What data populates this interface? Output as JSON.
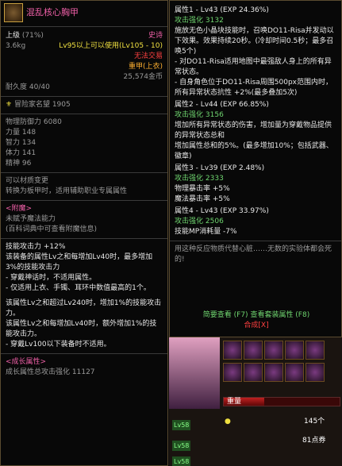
{
  "item": {
    "name": "混乱核心胸甲",
    "grade": "上级",
    "grade_pct": "(71%)",
    "rarity": "史诗",
    "weight": "3.6kg",
    "level_req": "Lv95以上可以使用(Lv105 - 10)",
    "trade": "无法交易",
    "type": "重甲(上衣)",
    "price": "25,574金币",
    "durability": "耐久度 40/40",
    "fame": "冒险家名望 1905",
    "stats": [
      {
        "label": "物理防御力",
        "value": "6080"
      },
      {
        "label": "力量",
        "value": "148"
      },
      {
        "label": "智力",
        "value": "134"
      },
      {
        "label": "体力",
        "value": "141"
      },
      {
        "label": "精神",
        "value": "96"
      }
    ],
    "material_change": "可以材质变更",
    "material_desc": "转换为板甲时，适用辅助职业专属属性",
    "enchant_header": "<附魔>",
    "enchant_none": "未赋予魔法能力",
    "enchant_hint": "(百科词典中可查看附魔信息)",
    "skill_atk": "技能攻击力 +12%",
    "desc1": [
      "该装备的属性Lv之和每增加Lv40时，最多增加3%的技能攻击力",
      "- 穿戴神话时，不适用属性。",
      "- 仅适用上衣、手镯、耳环中数值最高的1个。"
    ],
    "desc2": [
      "该属性Lv之和超过Lv240时，增加1%的技能攻击力。",
      "该属性Lv之和每增加Lv40时，额外增加1%的技能攻击力。",
      "- 穿戴Lv100以下装备时不适用。"
    ],
    "growth_header": "<成长属性>",
    "growth_total": "成长属性总攻击强化",
    "growth_value": "11127"
  },
  "attrs": [
    {
      "title": "属性1 - Lv43 (EXP 24.36%)",
      "atk_label": "攻击强化",
      "atk": "3132",
      "lines": [
        "施放无色小晶块技能时，召唤DO11-Risa并发动以下效果。效果持续20秒。(冷却时间0.5秒；最多召唤5个)",
        "- 对DO11-Risa适用地图中最强敌人身上的所有异常状态。",
        "- 自身角色位于DO11-Risa周围500px范围内时，所有异常状态抗性 +2%(最多叠加5次)"
      ]
    },
    {
      "title": "属性2 - Lv44 (EXP 66.85%)",
      "atk_label": "攻击强化",
      "atk": "3156",
      "lines": [
        "增加所有异常状态的伤害，增加量为穿戴物品提供的异常状态总和",
        "增加属性总和的5%。(最多增加10%；包括武器、徽章)"
      ]
    },
    {
      "title": "属性3 - Lv39 (EXP 2.48%)",
      "atk_label": "攻击强化",
      "atk": "2333",
      "lines": [
        "物理暴击率 +5%",
        "魔法暴击率 +5%"
      ]
    },
    {
      "title": "属性4 - Lv43 (EXP 33.97%)",
      "atk_label": "攻击强化",
      "atk": "2506",
      "lines": [
        "技能MP消耗量 -7%"
      ]
    }
  ],
  "flavor": "用这种反应物质代替心脏……无数的实验体都会死的!",
  "buttons": {
    "brief": "简要查看 (F7)",
    "set": "查看套装属性 (F8)",
    "combine": "合成[X]"
  },
  "game": {
    "weight_label": "重量",
    "count": "145个",
    "points": "81点券",
    "badges": [
      "Lv58",
      "Lv58",
      "Lv58"
    ]
  },
  "colors": {
    "gold": "#f0e040",
    "green": "#6fd56f",
    "red": "#ff4040",
    "pink": "#f060a8"
  }
}
